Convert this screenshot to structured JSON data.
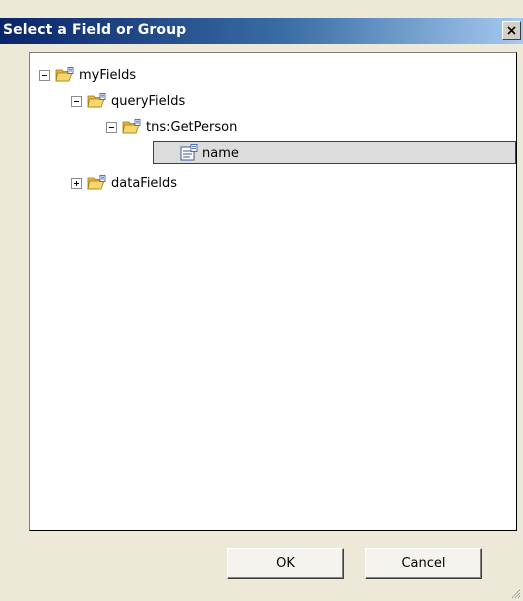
{
  "window": {
    "title": "Select a Field or Group",
    "close_glyph": "X"
  },
  "tree": {
    "root": {
      "label": "myFields",
      "expanded": true,
      "icon": "folder-icon"
    },
    "queryFields": {
      "label": "queryFields",
      "expanded": true,
      "icon": "folder-icon"
    },
    "getPerson": {
      "label": "tns:GetPerson",
      "expanded": true,
      "icon": "folder-icon"
    },
    "name": {
      "label": "name",
      "selected": true,
      "icon": "field-icon"
    },
    "dataFields": {
      "label": "dataFields",
      "expanded": false,
      "icon": "folder-icon"
    }
  },
  "buttons": {
    "ok": "OK",
    "cancel": "Cancel"
  },
  "colors": {
    "titlebar_start": "#0a246a",
    "titlebar_end": "#a6caf0",
    "dialog_bg": "#ece9d8",
    "folder_yellow": "#f5c842"
  }
}
